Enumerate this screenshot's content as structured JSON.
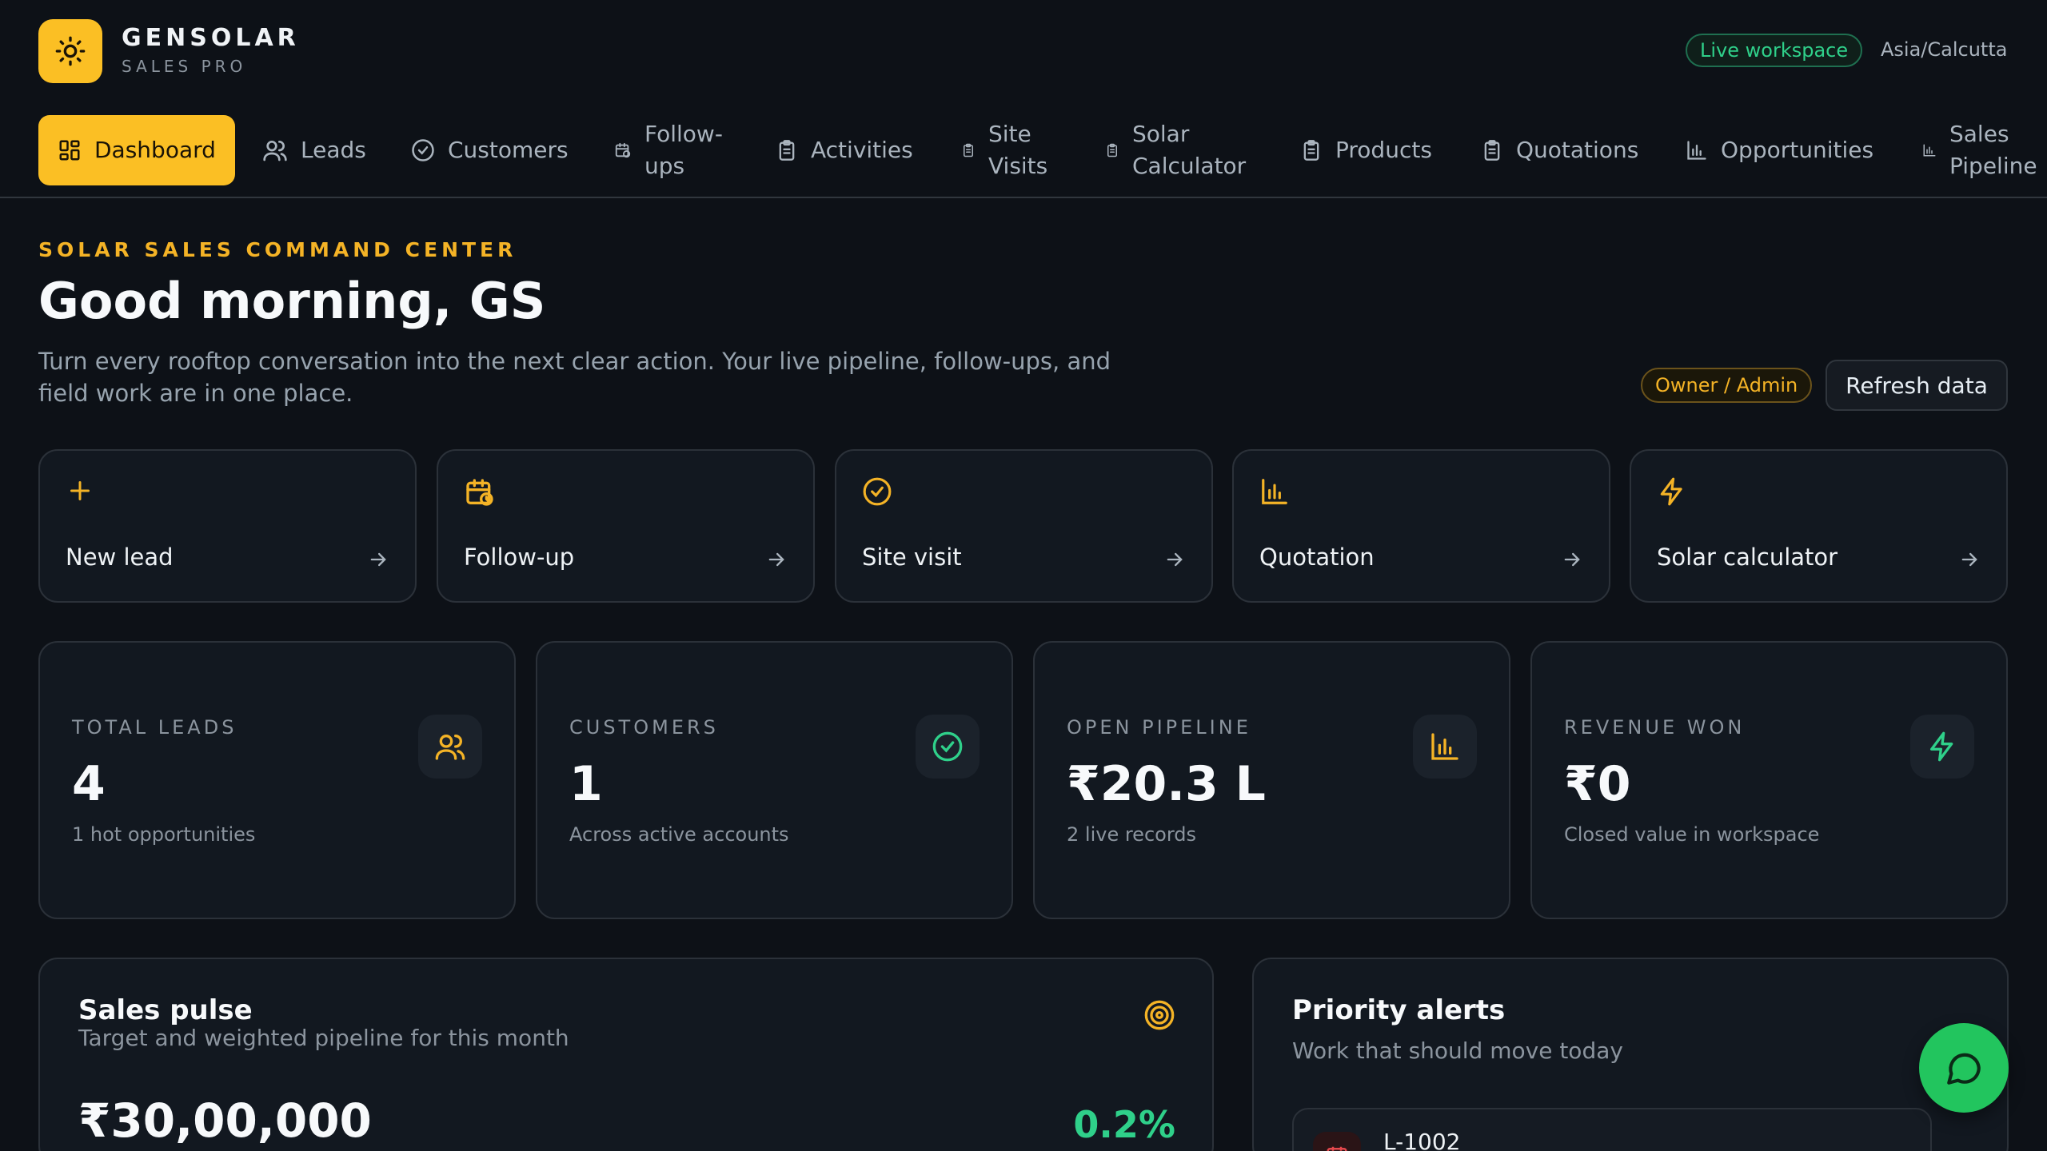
{
  "brand": {
    "name": "GENSOLAR",
    "subtitle": "SALES PRO"
  },
  "header": {
    "status_badge": "Live workspace",
    "timezone": "Asia/Calcutta"
  },
  "nav": {
    "items": [
      {
        "label": "Dashboard",
        "icon": "dashboard-grid-icon",
        "active": true
      },
      {
        "label": "Leads",
        "icon": "users-icon"
      },
      {
        "label": "Customers",
        "icon": "check-circle-icon"
      },
      {
        "label": "Follow-ups",
        "icon": "calendar-clock-icon"
      },
      {
        "label": "Activities",
        "icon": "clipboard-icon"
      },
      {
        "label": "Site Visits",
        "icon": "clipboard-icon"
      },
      {
        "label": "Solar Calculator",
        "icon": "clipboard-icon"
      },
      {
        "label": "Products",
        "icon": "clipboard-icon"
      },
      {
        "label": "Quotations",
        "icon": "clipboard-icon"
      },
      {
        "label": "Opportunities",
        "icon": "bar-chart-icon"
      },
      {
        "label": "Sales Pipeline",
        "icon": "bar-chart-icon"
      }
    ]
  },
  "hero": {
    "eyebrow": "SOLAR SALES COMMAND CENTER",
    "greeting": "Good morning, GS",
    "intro": "Turn every rooftop conversation into the next clear action. Your live pipeline, follow-ups, and field work are in one place.",
    "role_badge": "Owner / Admin",
    "refresh_label": "Refresh data"
  },
  "quick_actions": [
    {
      "label": "New lead",
      "icon": "plus-icon"
    },
    {
      "label": "Follow-up",
      "icon": "calendar-clock-icon"
    },
    {
      "label": "Site visit",
      "icon": "check-circle-icon"
    },
    {
      "label": "Quotation",
      "icon": "bar-chart-icon"
    },
    {
      "label": "Solar calculator",
      "icon": "lightning-icon"
    }
  ],
  "stats": [
    {
      "label": "TOTAL LEADS",
      "value": "4",
      "note": "1 hot opportunities",
      "icon": "users-icon"
    },
    {
      "label": "CUSTOMERS",
      "value": "1",
      "note": "Across active accounts",
      "icon": "check-circle-icon"
    },
    {
      "label": "OPEN PIPELINE",
      "value": "₹20.3 L",
      "note": "2 live records",
      "icon": "bar-chart-icon"
    },
    {
      "label": "REVENUE WON",
      "value": "₹0",
      "note": "Closed value in workspace",
      "icon": "lightning-icon"
    }
  ],
  "sales_pulse": {
    "title": "Sales pulse",
    "subtitle": "Target and weighted pipeline for this month",
    "target": "₹30,00,000",
    "percent": "0.2%"
  },
  "priority_alerts": {
    "title": "Priority alerts",
    "subtitle": "Work that should move today",
    "items": [
      {
        "id": "L-1002"
      }
    ]
  },
  "colors": {
    "accent": "#fbbf24",
    "success": "#22c55e",
    "background": "#0d1117",
    "card": "#121820"
  }
}
